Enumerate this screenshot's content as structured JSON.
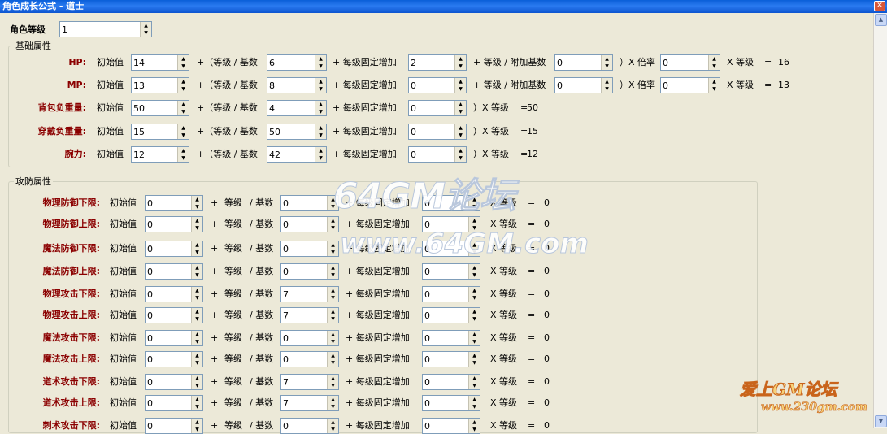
{
  "window": {
    "title": "角色成长公式 - 道士",
    "close_glyph": "✕"
  },
  "level": {
    "label": "角色等级",
    "value": "1"
  },
  "basic": {
    "legend": "基础属性",
    "rows": [
      {
        "name": "HP:",
        "init_label": "初始值",
        "init": "14",
        "plus_open": "+（等级 / 基数",
        "base": "6",
        "fixed_label": "+ 每级固定增加",
        "fixed": "2",
        "extra_label": "+ 等级 / 附加基数",
        "extra": "0",
        "mult_label": "）X 倍率",
        "mult": "0",
        "tail": "X 等级",
        "eq": "=",
        "result": "16"
      },
      {
        "name": "MP:",
        "init_label": "初始值",
        "init": "13",
        "plus_open": "+（等级 / 基数",
        "base": "8",
        "fixed_label": "+ 每级固定增加",
        "fixed": "0",
        "extra_label": "+ 等级 / 附加基数",
        "extra": "0",
        "mult_label": "）X 倍率",
        "mult": "0",
        "tail": "X 等级",
        "eq": "=",
        "result": "13"
      },
      {
        "name": "背包负重量:",
        "init_label": "初始值",
        "init": "50",
        "plus_open": "+（等级 / 基数",
        "base": "4",
        "fixed_label": "+ 每级固定增加",
        "fixed": "0",
        "tail": "）X 等级",
        "eq": "=",
        "result": "50"
      },
      {
        "name": "穿戴负重量:",
        "init_label": "初始值",
        "init": "15",
        "plus_open": "+（等级 / 基数",
        "base": "50",
        "fixed_label": "+ 每级固定增加",
        "fixed": "0",
        "tail": "）X 等级",
        "eq": "=",
        "result": "15"
      },
      {
        "name": "腕力:",
        "init_label": "初始值",
        "init": "12",
        "plus_open": "+（等级 / 基数",
        "base": "42",
        "fixed_label": "+ 每级固定增加",
        "fixed": "0",
        "tail": "）X 等级",
        "eq": "=",
        "result": "12"
      }
    ]
  },
  "combat": {
    "legend": "攻防属性",
    "init_label": "初始值",
    "plus1": "+",
    "lvl_label": "等级",
    "base_label": "/ 基数",
    "fixed_label": "+ 每级固定增加",
    "tail": "X 等级",
    "eq": "=",
    "rows": [
      {
        "name": "物理防御下限:",
        "init": "0",
        "base": "0",
        "fixed": "0",
        "result": "0"
      },
      {
        "name": "物理防御上限:",
        "init": "0",
        "base": "0",
        "fixed": "0",
        "result": "0"
      },
      {
        "name": "魔法防御下限:",
        "init": "0",
        "base": "0",
        "fixed": "0",
        "result": "0"
      },
      {
        "name": "魔法防御上限:",
        "init": "0",
        "base": "0",
        "fixed": "0",
        "result": "0"
      },
      {
        "name": "物理攻击下限:",
        "init": "0",
        "base": "7",
        "fixed": "0",
        "result": "0"
      },
      {
        "name": "物理攻击上限:",
        "init": "0",
        "base": "7",
        "fixed": "0",
        "result": "0"
      },
      {
        "name": "魔法攻击下限:",
        "init": "0",
        "base": "0",
        "fixed": "0",
        "result": "0"
      },
      {
        "name": "魔法攻击上限:",
        "init": "0",
        "base": "0",
        "fixed": "0",
        "result": "0"
      },
      {
        "name": "道术攻击下限:",
        "init": "0",
        "base": "7",
        "fixed": "0",
        "result": "0"
      },
      {
        "name": "道术攻击上限:",
        "init": "0",
        "base": "7",
        "fixed": "0",
        "result": "0"
      },
      {
        "name": "刺术攻击下限:",
        "init": "0",
        "base": "0",
        "fixed": "0",
        "result": "0"
      }
    ]
  },
  "watermarks": {
    "forum_cn": "64GM论坛",
    "forum_url": "www.64GM.com",
    "corner_cn": "爱上GM论坛",
    "corner_url": "www.230gm.com"
  }
}
